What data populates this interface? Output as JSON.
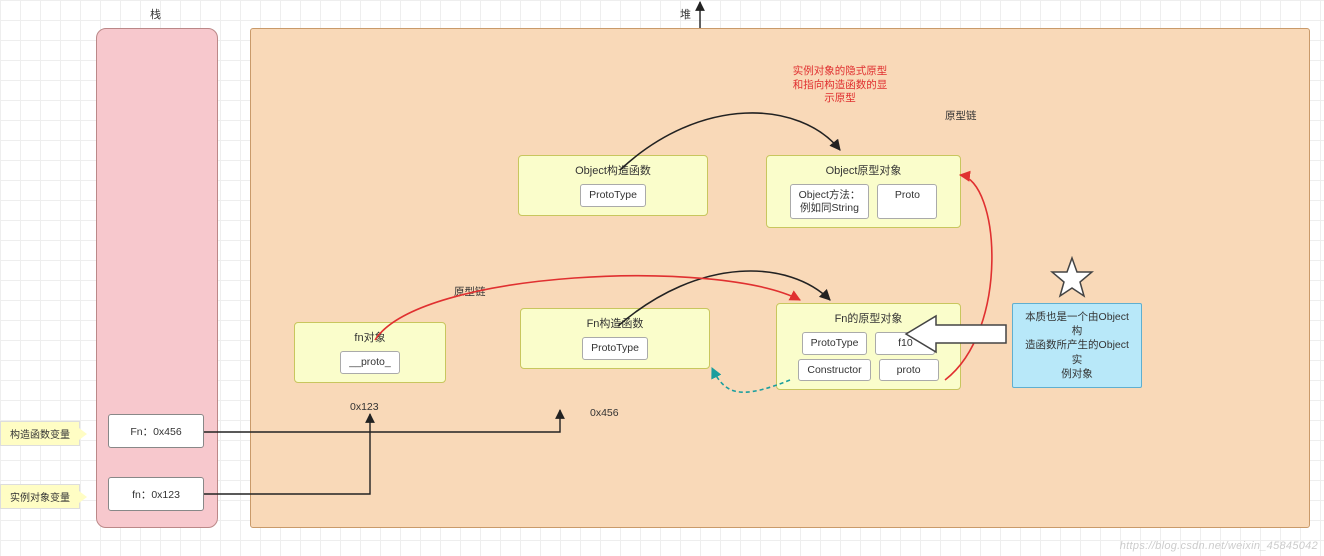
{
  "headers": {
    "stack": "栈",
    "heap": "堆"
  },
  "side_labels": {
    "constructor_var": "构造函数变量",
    "instance_var": "实例对象变量"
  },
  "stack_boxes": {
    "fn_ctor": "Fn：0x456",
    "fn_inst": "fn：0x123"
  },
  "nodes": {
    "obj_ctor": {
      "title": "Object构造函数",
      "slots": [
        "ProtoType"
      ]
    },
    "obj_proto": {
      "title": "Object原型对象",
      "slots": [
        "Object方法：\n例如同String",
        "Proto"
      ]
    },
    "fn_obj": {
      "title": "fn对象",
      "slots": [
        "__proto_"
      ],
      "addr": "0x123"
    },
    "fn_ctor": {
      "title": "Fn构造函数",
      "slots": [
        "ProtoType"
      ],
      "addr": "0x456"
    },
    "fn_proto": {
      "title": "Fn的原型对象",
      "row1": [
        "ProtoType",
        "f10"
      ],
      "row2": [
        "Constructor",
        "proto"
      ]
    }
  },
  "annotations": {
    "red_note": "实例对象的隐式原型\n和指向构造函数的显\n示原型",
    "proto_chain": "原型链",
    "callout": "本质也是一个由Object构\n造函数所产生的Object实\n例对象"
  },
  "watermark": "https://blog.csdn.net/weixin_45845042",
  "chart_data": {
    "type": "diagram",
    "title": "JavaScript 原型链 / Prototype Chain (Stack & Heap)",
    "regions": [
      {
        "id": "stack",
        "label": "栈"
      },
      {
        "id": "heap",
        "label": "堆"
      }
    ],
    "stack_items": [
      {
        "id": "var-Fn",
        "label": "Fn：0x456",
        "points_to": "fn_ctor",
        "note": "构造函数变量"
      },
      {
        "id": "var-fn",
        "label": "fn：0x123",
        "points_to": "fn_obj",
        "note": "实例对象变量"
      }
    ],
    "heap_objects": [
      {
        "id": "obj_ctor",
        "label": "Object构造函数",
        "properties": [
          "ProtoType"
        ]
      },
      {
        "id": "obj_proto",
        "label": "Object原型对象",
        "properties": [
          "Object方法：例如同String",
          "Proto"
        ]
      },
      {
        "id": "fn_obj",
        "label": "fn对象",
        "address": "0x123",
        "properties": [
          "__proto_"
        ]
      },
      {
        "id": "fn_ctor",
        "label": "Fn构造函数",
        "address": "0x456",
        "properties": [
          "ProtoType"
        ]
      },
      {
        "id": "fn_proto",
        "label": "Fn的原型对象",
        "properties": [
          "ProtoType",
          "f10",
          "Constructor",
          "proto"
        ],
        "note": "本质也是一个由Object构造函数所产生的Object实例对象"
      }
    ],
    "edges": [
      {
        "from": "var-Fn",
        "to": "fn_ctor",
        "kind": "pointer"
      },
      {
        "from": "var-fn",
        "to": "fn_obj",
        "kind": "pointer"
      },
      {
        "from": "obj_ctor.ProtoType",
        "to": "obj_proto",
        "kind": "显示原型",
        "note": "实例对象的隐式原型和指向构造函数的显示原型"
      },
      {
        "from": "fn_ctor.ProtoType",
        "to": "fn_proto",
        "kind": "显示原型"
      },
      {
        "from": "fn_obj.__proto_",
        "to": "fn_proto",
        "kind": "原型链"
      },
      {
        "from": "fn_proto.Constructor",
        "to": "fn_ctor",
        "kind": "constructor"
      },
      {
        "from": "fn_proto.proto",
        "to": "obj_proto",
        "kind": "原型链"
      }
    ]
  }
}
